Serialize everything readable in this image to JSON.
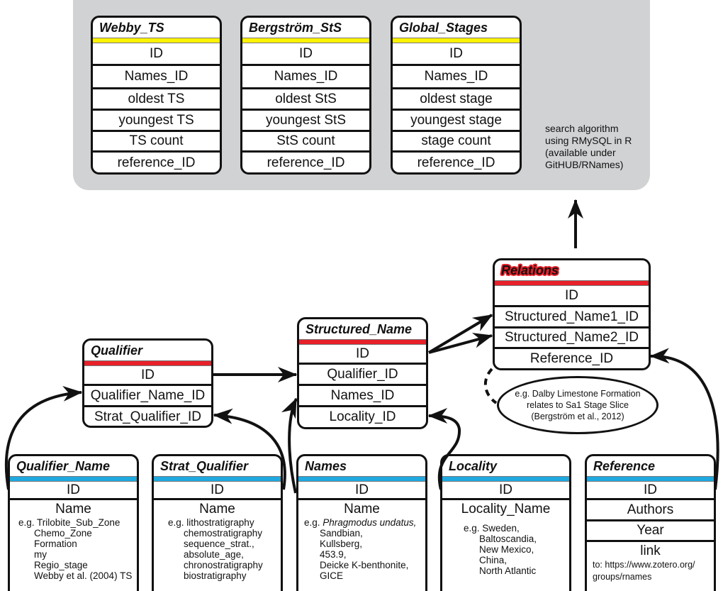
{
  "top_panel": {
    "tables": [
      {
        "title": "Webby_TS",
        "header_color": "#fff200",
        "fields": [
          "ID",
          "Names_ID",
          "oldest TS",
          "youngest TS",
          "TS count",
          "reference_ID"
        ]
      },
      {
        "title": "Bergström_StS",
        "header_color": "#fff200",
        "fields": [
          "ID",
          "Names_ID",
          "oldest StS",
          "youngest StS",
          "StS count",
          "reference_ID"
        ]
      },
      {
        "title": "Global_Stages",
        "header_color": "#fff200",
        "fields": [
          "ID",
          "Names_ID",
          "oldest stage",
          "youngest stage",
          "stage count",
          "reference_ID"
        ]
      }
    ],
    "note_lines": [
      "search algorithm",
      "using RMySQL in R",
      "(available under",
      "GitHUB/RNames)"
    ],
    "background_color": "#d1d2d4"
  },
  "relations": {
    "title": "Relations",
    "header_color": "#e8202a",
    "fields": [
      "ID",
      "Structured_Name1_ID",
      "Structured_Name2_ID",
      "Reference_ID"
    ],
    "example_lines": [
      "e.g. Dalby Limestone Formation",
      "relates to Sa1 Stage Slice",
      "(Bergström et al., 2012)"
    ]
  },
  "structured_name": {
    "title": "Structured_Name",
    "header_color": "#e8202a",
    "fields": [
      "ID",
      "Qualifier_ID",
      "Names_ID",
      "Locality_ID"
    ]
  },
  "qualifier": {
    "title": "Qualifier",
    "header_color": "#e8202a",
    "fields": [
      "ID",
      "Qualifier_Name_ID",
      "Strat_Qualifier_ID"
    ]
  },
  "bottom_tables": {
    "qualifier_name": {
      "title": "Qualifier_Name",
      "header_color": "#1fa9e1",
      "id": "ID",
      "name": "Name",
      "examples": [
        "e.g. Trilobite_Sub_Zone",
        "Chemo_Zone",
        "Formation",
        "my",
        "Regio_stage",
        "Webby et al. (2004) TS"
      ]
    },
    "strat_qualifier": {
      "title": "Strat_Qualifier",
      "header_color": "#1fa9e1",
      "id": "ID",
      "name": "Name",
      "examples": [
        "e.g. lithostratigraphy",
        "chemostratigraphy",
        "sequence_strat.,",
        "absolute_age,",
        "chronostratigraphy",
        "biostratigraphy"
      ]
    },
    "names": {
      "title": "Names",
      "header_color": "#1fa9e1",
      "id": "ID",
      "name": "Name",
      "examples_prefix": "e.g. ",
      "examples_first_italic": "Phragmodus undatus,",
      "examples": [
        "Sandbian,",
        "Kullsberg,",
        "453.9,",
        "Deicke K-benthonite,",
        "GICE"
      ]
    },
    "locality": {
      "title": "Locality",
      "header_color": "#1fa9e1",
      "id": "ID",
      "name": "Locality_Name",
      "examples": [
        "e.g. Sweden,",
        "Baltoscandia,",
        "New Mexico,",
        "China,",
        "North Atlantic"
      ]
    },
    "reference": {
      "title": "Reference",
      "header_color": "#1fa9e1",
      "fields": [
        "ID",
        "Authors",
        "Year"
      ],
      "link_label": "link",
      "link_lines": [
        "to:  https://www.zotero.org/",
        "groups/rnames"
      ]
    }
  }
}
